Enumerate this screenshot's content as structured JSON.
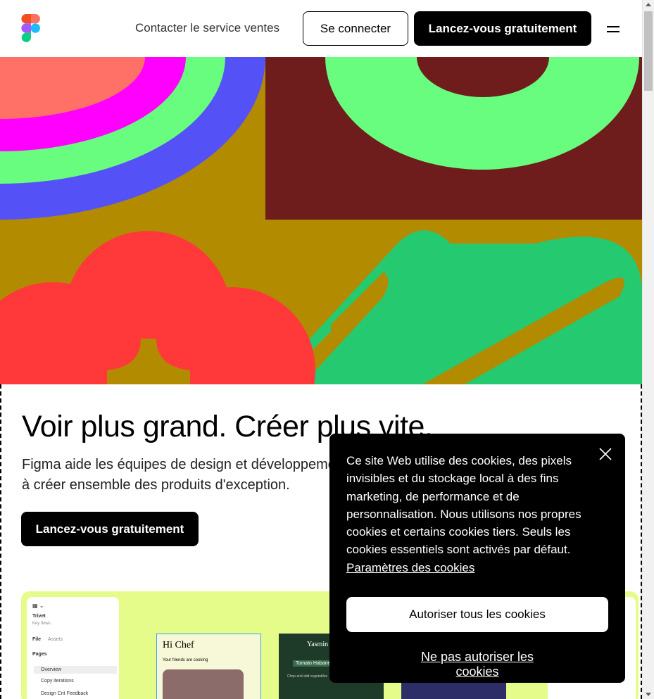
{
  "header": {
    "contact_sales": "Contacter le service ventes",
    "login": "Se connecter",
    "start": "Lancez-vous gratuitement"
  },
  "hero": {
    "headline": "Voir plus grand. Créer plus vite.",
    "subhead": "Figma aide les équipes de design et développement à créer ensemble des produits d'exception.",
    "cta": "Lancez-vous gratuitement"
  },
  "preview": {
    "file_name": "Trivet",
    "file_sub": "Key flows",
    "tab_file": "File",
    "tab_assets": "Assets",
    "pages_label": "Pages",
    "pages": [
      "Overview",
      "Copy iterations",
      "Design Crit Feedback"
    ],
    "card1_title": "Hi Chef",
    "card1_sub": "Your friends are cooking",
    "card2_title": "Yasmin",
    "card2_tag": "Tomato Habanero",
    "card2_sub": "Chop and add vegetables"
  },
  "cookie": {
    "text": "Ce site Web utilise des cookies, des pixels invisibles et du stockage local à des fins marketing, de performance et de personnalisation. Nous utilisons nos propres cookies et certains cookies tiers. Seuls les cookies essentiels sont activés par défaut.",
    "settings_link": "Paramètres des cookies",
    "allow": "Autoriser tous les cookies",
    "deny": "Ne pas autoriser les cookies"
  },
  "colors": {
    "ochre": "#b38b00",
    "maroon": "#6f1c1d",
    "green": "#68fd7e",
    "magenta": "#ff00ff",
    "salmon": "#ff7066",
    "blue": "#5452f6",
    "red": "#ff3939",
    "dark_green": "#24c970",
    "lime": "#e5fc8a"
  }
}
